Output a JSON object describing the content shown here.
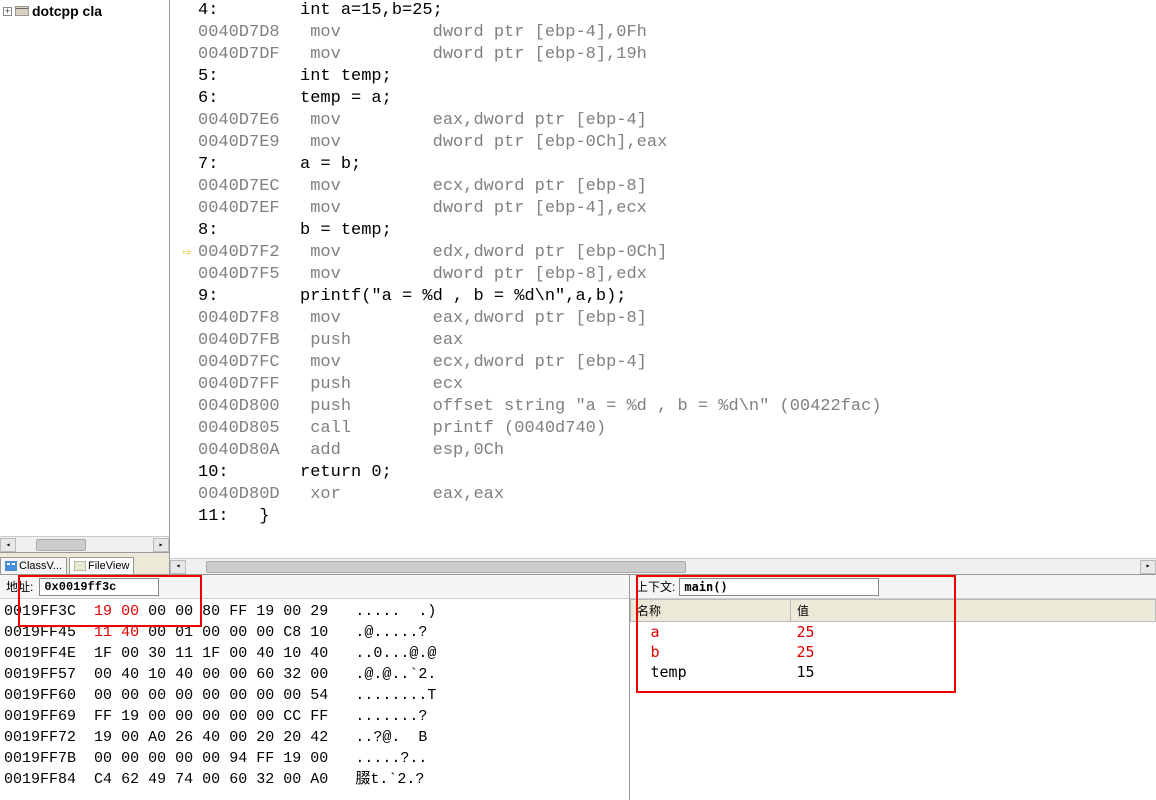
{
  "tree": {
    "expander": "+",
    "label": "dotcpp cla"
  },
  "tabs": {
    "class_view": "ClassV...",
    "file_view": "FileView"
  },
  "code": {
    "rows": [
      {
        "g": "",
        "t": "4:        int a=15,b=25;",
        "cls": "src-text",
        "indent": 0
      },
      {
        "g": "",
        "t": "0040D7D8   mov         dword ptr [ebp-4],0Fh",
        "cls": "asm-text",
        "indent": 0
      },
      {
        "g": "",
        "t": "0040D7DF   mov         dword ptr [ebp-8],19h",
        "cls": "asm-text",
        "indent": 0
      },
      {
        "g": "",
        "t": "5:        int temp;",
        "cls": "src-text",
        "indent": 0
      },
      {
        "g": "",
        "t": "6:        temp = a;",
        "cls": "src-text",
        "indent": 0
      },
      {
        "g": "",
        "t": "0040D7E6   mov         eax,dword ptr [ebp-4]",
        "cls": "asm-text",
        "indent": 0
      },
      {
        "g": "",
        "t": "0040D7E9   mov         dword ptr [ebp-0Ch],eax",
        "cls": "asm-text",
        "indent": 0
      },
      {
        "g": "",
        "t": "7:        a = b;",
        "cls": "src-text",
        "indent": 0
      },
      {
        "g": "",
        "t": "0040D7EC   mov         ecx,dword ptr [ebp-8]",
        "cls": "asm-text",
        "indent": 0
      },
      {
        "g": "",
        "t": "0040D7EF   mov         dword ptr [ebp-4],ecx",
        "cls": "asm-text",
        "indent": 0
      },
      {
        "g": "",
        "t": "8:        b = temp;",
        "cls": "src-text",
        "indent": 0
      },
      {
        "g": "⇨",
        "t": "0040D7F2   mov         edx,dword ptr [ebp-0Ch]",
        "cls": "asm-text",
        "indent": 0
      },
      {
        "g": "",
        "t": "0040D7F5   mov         dword ptr [ebp-8],edx",
        "cls": "asm-text",
        "indent": 0
      },
      {
        "g": "",
        "t": "9:        printf(\"a = %d , b = %d\\n\",a,b);",
        "cls": "src-text",
        "indent": 0
      },
      {
        "g": "",
        "t": "0040D7F8   mov         eax,dword ptr [ebp-8]",
        "cls": "asm-text",
        "indent": 0
      },
      {
        "g": "",
        "t": "0040D7FB   push        eax",
        "cls": "asm-text",
        "indent": 0
      },
      {
        "g": "",
        "t": "0040D7FC   mov         ecx,dword ptr [ebp-4]",
        "cls": "asm-text",
        "indent": 0
      },
      {
        "g": "",
        "t": "0040D7FF   push        ecx",
        "cls": "asm-text",
        "indent": 0
      },
      {
        "g": "",
        "t": "0040D800   push        offset string \"a = %d , b = %d\\n\" (00422fac)",
        "cls": "asm-text",
        "indent": 0
      },
      {
        "g": "",
        "t": "0040D805   call        printf (0040d740)",
        "cls": "asm-text",
        "indent": 0
      },
      {
        "g": "",
        "t": "0040D80A   add         esp,0Ch",
        "cls": "asm-text",
        "indent": 0
      },
      {
        "g": "",
        "t": "10:       return 0;",
        "cls": "src-text",
        "indent": 0
      },
      {
        "g": "",
        "t": "0040D80D   xor         eax,eax",
        "cls": "asm-text",
        "indent": 0
      },
      {
        "g": "",
        "t": "11:   }",
        "cls": "src-text",
        "indent": 0
      }
    ]
  },
  "memory": {
    "addr_label": "地址:",
    "addr_value": "0x0019ff3c",
    "lines": [
      {
        "addr": "0019FF3C",
        "hex": [
          "19",
          "00",
          "00",
          "00",
          "80",
          "FF",
          "19",
          "00",
          "29"
        ],
        "red": [
          0,
          1
        ],
        "ascii": ".....  .)"
      },
      {
        "addr": "0019FF45",
        "hex": [
          "11",
          "40",
          "00",
          "01",
          "00",
          "00",
          "00",
          "C8",
          "10"
        ],
        "red": [
          0,
          1
        ],
        "ascii": ".@.....?"
      },
      {
        "addr": "0019FF4E",
        "hex": [
          "1F",
          "00",
          "30",
          "11",
          "1F",
          "00",
          "40",
          "10",
          "40"
        ],
        "red": [],
        "ascii": "..0...@.@"
      },
      {
        "addr": "0019FF57",
        "hex": [
          "00",
          "40",
          "10",
          "40",
          "00",
          "00",
          "60",
          "32",
          "00"
        ],
        "red": [],
        "ascii": ".@.@..`2."
      },
      {
        "addr": "0019FF60",
        "hex": [
          "00",
          "00",
          "00",
          "00",
          "00",
          "00",
          "00",
          "00",
          "54"
        ],
        "red": [],
        "ascii": "........T"
      },
      {
        "addr": "0019FF69",
        "hex": [
          "FF",
          "19",
          "00",
          "00",
          "00",
          "00",
          "00",
          "CC",
          "FF"
        ],
        "red": [],
        "ascii": ".......?"
      },
      {
        "addr": "0019FF72",
        "hex": [
          "19",
          "00",
          "A0",
          "26",
          "40",
          "00",
          "20",
          "20",
          "42"
        ],
        "red": [],
        "ascii": "..?@.  B"
      },
      {
        "addr": "0019FF7B",
        "hex": [
          "00",
          "00",
          "00",
          "00",
          "00",
          "94",
          "FF",
          "19",
          "00"
        ],
        "red": [],
        "ascii": ".....?.."
      },
      {
        "addr": "0019FF84",
        "hex": [
          "C4",
          "62",
          "49",
          "74",
          "00",
          "60",
          "32",
          "00",
          "A0"
        ],
        "red": [],
        "ascii": "腏t.`2.?"
      }
    ]
  },
  "watch": {
    "ctx_label": "上下文:",
    "ctx_value": "main()",
    "col_name": "名称",
    "col_value": "值",
    "rows": [
      {
        "name": "a",
        "value": "25",
        "red": true
      },
      {
        "name": "b",
        "value": "25",
        "red": true
      },
      {
        "name": "temp",
        "value": "15",
        "red": false
      }
    ]
  }
}
